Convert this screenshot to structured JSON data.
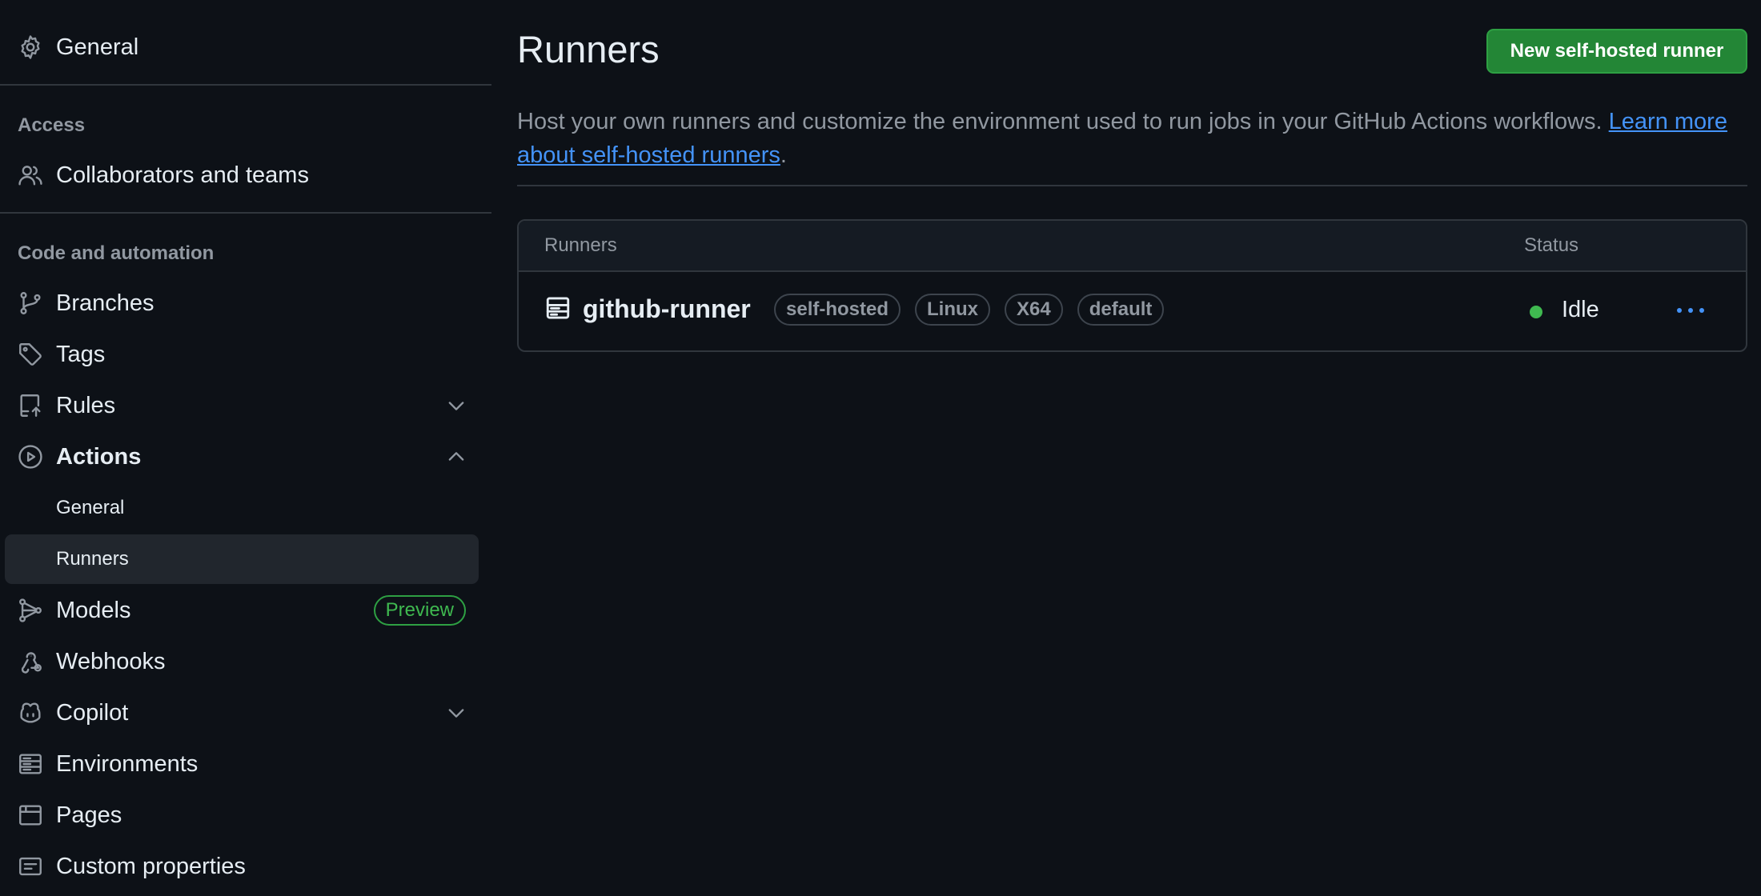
{
  "sidebar": {
    "top_item": {
      "label": "General",
      "icon": "gear-icon"
    },
    "sections": [
      {
        "heading": "Access"
      },
      {
        "heading": "Code and automation"
      }
    ],
    "items": {
      "collaborators": {
        "label": "Collaborators and teams",
        "icon": "people-icon"
      },
      "branches": {
        "label": "Branches",
        "icon": "git-branch-icon"
      },
      "tags": {
        "label": "Tags",
        "icon": "tag-icon"
      },
      "rules": {
        "label": "Rules",
        "icon": "repo-push-icon",
        "expanded": false
      },
      "actions": {
        "label": "Actions",
        "icon": "play-icon",
        "expanded": true,
        "children": [
          {
            "label": "General"
          },
          {
            "label": "Runners",
            "active": true
          }
        ]
      },
      "models": {
        "label": "Models",
        "icon": "models-icon",
        "badge": "Preview"
      },
      "webhooks": {
        "label": "Webhooks",
        "icon": "webhook-icon"
      },
      "copilot": {
        "label": "Copilot",
        "icon": "copilot-icon",
        "expanded": false
      },
      "environments": {
        "label": "Environments",
        "icon": "server-icon"
      },
      "pages": {
        "label": "Pages",
        "icon": "browser-icon"
      },
      "custom_properties": {
        "label": "Custom properties",
        "icon": "note-icon"
      }
    }
  },
  "main": {
    "title": "Runners",
    "new_button_label": "New self-hosted runner",
    "description": "Host your own runners and customize the environment used to run jobs in your GitHub Actions workflows.",
    "learn_more_link": "Learn more about self-hosted runners",
    "period": ".",
    "table": {
      "headers": {
        "runners": "Runners",
        "status": "Status"
      },
      "rows": [
        {
          "name": "github-runner",
          "labels": [
            "self-hosted",
            "Linux",
            "X64",
            "default"
          ],
          "status": "Idle"
        }
      ]
    }
  },
  "colors": {
    "background": "#0d1117",
    "accent_link": "#4493f8",
    "primary_button": "#238636",
    "status_idle": "#3fb950"
  }
}
